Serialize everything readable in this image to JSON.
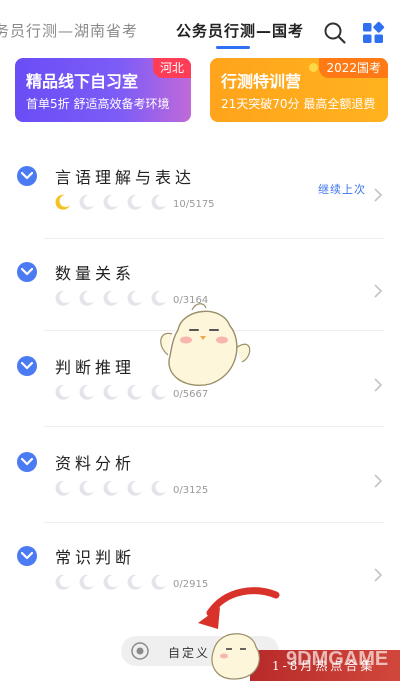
{
  "tabs": {
    "inactive": "务员行测—湖南省考",
    "active": "公务员行测—国考"
  },
  "banners": [
    {
      "title": "精品线下自习室",
      "subtitle": "首单5折 舒适高效备考环境",
      "tag": "河北"
    },
    {
      "title": "行测特训营",
      "subtitle": "21天突破70分 最高全额退费",
      "tag": "2022国考"
    }
  ],
  "categories": [
    {
      "title": "言语理解与表达",
      "progress": "10/5175",
      "filled_moons": 1,
      "continue_label": "继续上次"
    },
    {
      "title": "数量关系",
      "progress": "0/3164",
      "filled_moons": 0
    },
    {
      "title": "判断推理",
      "progress": "0/5667",
      "filled_moons": 0
    },
    {
      "title": "资料分析",
      "progress": "0/3125",
      "filled_moons": 0
    },
    {
      "title": "常识判断",
      "progress": "0/2915",
      "filled_moons": 0
    }
  ],
  "bottom": {
    "custom_label": "自定义",
    "promo_text": "1-8月热点合集",
    "watermark": "9DMGAME"
  },
  "colors": {
    "accent": "#4a7bf3",
    "tab_underline": "#2f6ff2",
    "banner_left": "#6a4df5",
    "banner_right": "#ffa41c",
    "moon_filled": "#f4c323",
    "moon_empty": "#e4e4ea"
  }
}
